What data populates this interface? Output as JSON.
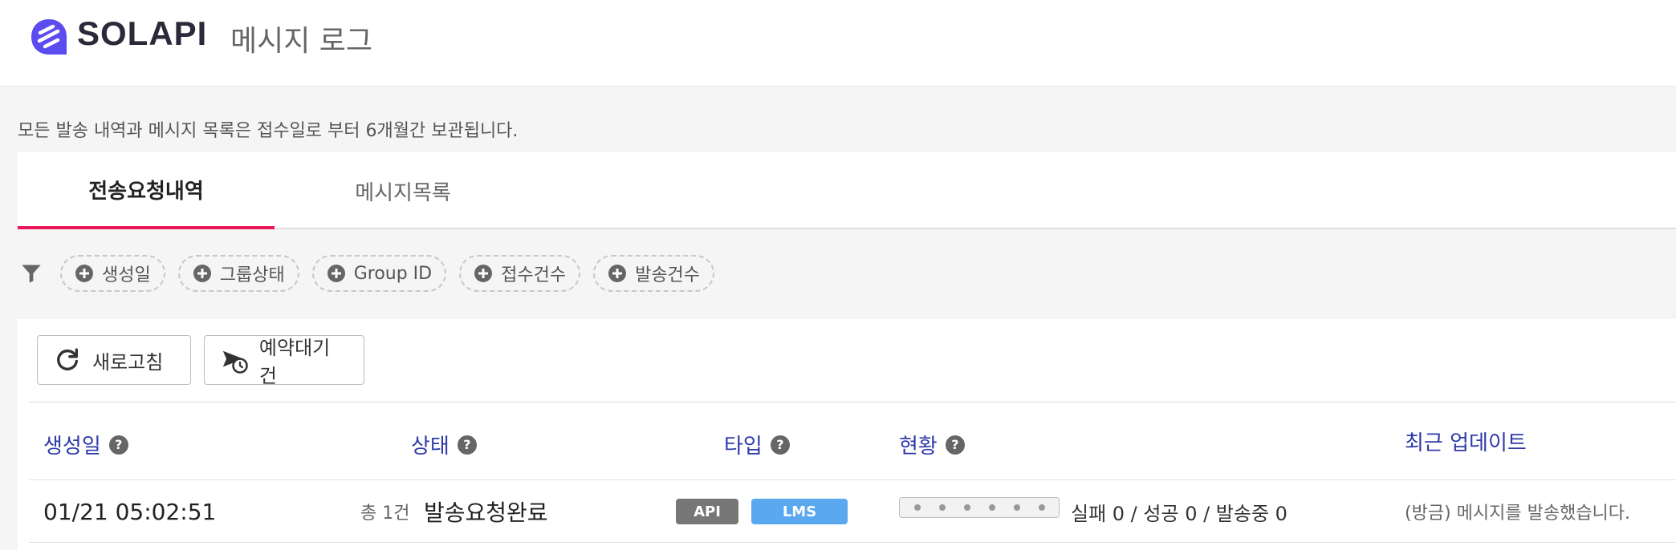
{
  "header": {
    "brand": "SOLAPI",
    "title": "메시지 로그"
  },
  "notice": "모든 발송 내역과 메시지 목록은 접수일로 부터 6개월간 보관됩니다.",
  "tabs": [
    {
      "label": "전송요청내역",
      "active": true
    },
    {
      "label": "메시지목록",
      "active": false
    }
  ],
  "filters": {
    "icon": "filter-icon",
    "chips": [
      "생성일",
      "그룹상태",
      "Group ID",
      "접수건수",
      "발송건수"
    ]
  },
  "toolbar": {
    "refresh_label": "새로고침",
    "reserve_label": "예약대기건"
  },
  "table": {
    "columns": {
      "created": "생성일",
      "status": "상태",
      "type": "타입",
      "progress": "현황",
      "recent": "최근 업데이트"
    },
    "help_glyph": "?",
    "rows": [
      {
        "created": "01/21 05:02:51",
        "total": "총 1건",
        "status": "발송요청완료",
        "badges": [
          "API",
          "LMS"
        ],
        "counts": "실패 0 / 성공 0 / 발송중 0",
        "recent": "(방금) 메시지를 발송했습니다."
      }
    ]
  },
  "colors": {
    "accent_tab": "#e8185a",
    "header_text": "#2d3aa8",
    "badge_api": "#777777",
    "badge_lms": "#5aa9f0",
    "logo": "#5b4cf0"
  }
}
